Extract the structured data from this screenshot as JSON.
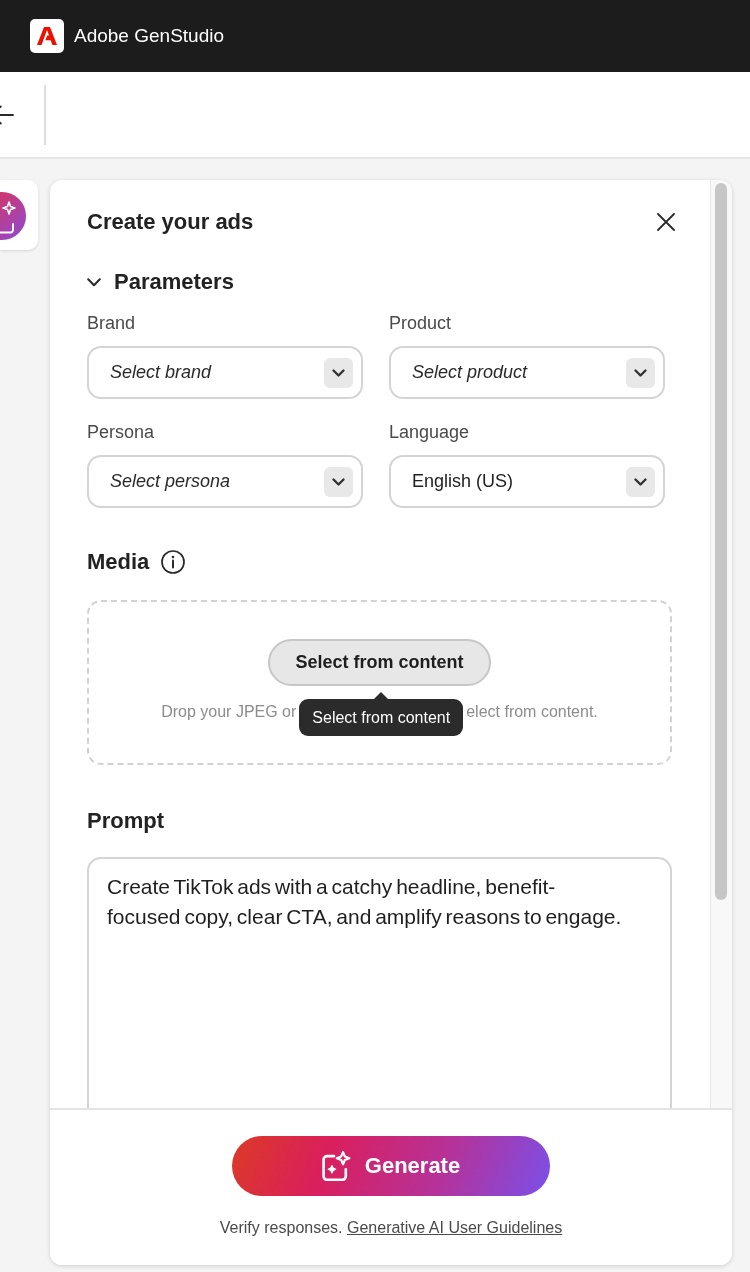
{
  "app_bar": {
    "title": "Adobe GenStudio"
  },
  "panel": {
    "title": "Create your ads"
  },
  "parameters": {
    "title": "Parameters",
    "expanded": true,
    "fields": [
      {
        "label": "Brand",
        "placeholder": "Select brand"
      },
      {
        "label": "Product",
        "placeholder": "Select product"
      },
      {
        "label": "Persona",
        "placeholder": "Select persona"
      },
      {
        "label": "Language",
        "value": "English (US)"
      }
    ]
  },
  "media": {
    "title": "Media",
    "button": "Select from content",
    "hint_parts": [
      "Drop your JPEG or",
      "elect from content."
    ],
    "tooltip": "Select from content"
  },
  "prompt": {
    "title": "Prompt",
    "value": "Create TikTok ads with a catchy headline, benefit-focused copy, clear CTA, and amplify reasons to engage."
  },
  "footer": {
    "button": "Generate",
    "note": "Verify responses.",
    "link": "Generative AI User Guidelines"
  }
}
